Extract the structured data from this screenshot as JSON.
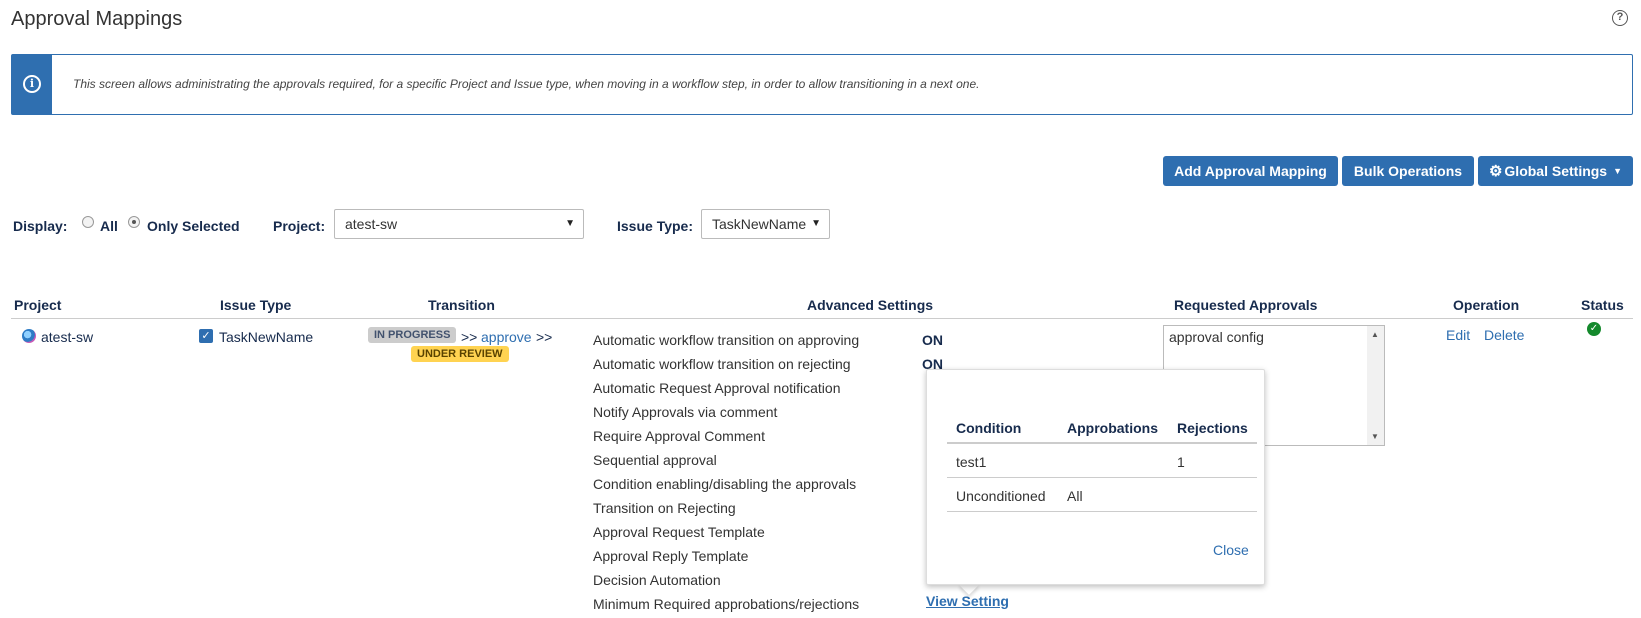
{
  "header": {
    "title": "Approval Mappings",
    "help_symbol": "?"
  },
  "info": {
    "icon_symbol": "i",
    "text": "This screen allows administrating the approvals required, for a specific Project and Issue type, when moving in a workflow step, in order to allow transitioning in a next one."
  },
  "toolbar": {
    "add_label": "Add Approval Mapping",
    "bulk_label": "Bulk Operations",
    "global_label": "Global Settings"
  },
  "filters": {
    "display_label": "Display:",
    "all_label": "All",
    "only_selected_label": "Only Selected",
    "selected_display": "Only Selected",
    "project_label": "Project:",
    "project_value": "atest-sw",
    "issue_type_label": "Issue Type:",
    "issue_type_value": "TaskNewName"
  },
  "table": {
    "columns": [
      "Project",
      "Issue Type",
      "Transition",
      "Advanced Settings",
      "Requested Approvals",
      "Operation",
      "Status"
    ],
    "row": {
      "project": "atest-sw",
      "issue_type": "TaskNewName",
      "transition_from": "IN PROGRESS",
      "transition_sep1": ">>",
      "transition_action": "approve",
      "transition_sep2": ">>",
      "transition_to": "UNDER REVIEW",
      "settings": [
        {
          "label": "Automatic workflow transition on approving",
          "value": "ON"
        },
        {
          "label": "Automatic workflow transition on rejecting",
          "value": "ON"
        },
        {
          "label": "Automatic Request Approval notification"
        },
        {
          "label": "Notify Approvals via comment"
        },
        {
          "label": "Require Approval Comment"
        },
        {
          "label": "Sequential approval"
        },
        {
          "label": "Condition enabling/disabling the approvals"
        },
        {
          "label": "Transition on Rejecting"
        },
        {
          "label": "Approval Request Template"
        },
        {
          "label": "Approval Reply Template"
        },
        {
          "label": "Decision Automation"
        },
        {
          "label": "Minimum Required approbations/rejections"
        }
      ],
      "view_setting_label": "View Setting",
      "requested_approvals": "approval config",
      "edit_label": "Edit",
      "delete_label": "Delete"
    }
  },
  "popup": {
    "columns": [
      "Condition",
      "Approbations",
      "Rejections"
    ],
    "rows": [
      {
        "condition": "test1",
        "approbations": "",
        "rejections": "1"
      },
      {
        "condition": "Unconditioned",
        "approbations": "All",
        "rejections": ""
      }
    ],
    "close_label": "Close"
  },
  "colors": {
    "accent": "#2e6eb0",
    "status_ok": "#14892c",
    "lozenge_in_progress": "#cccccc",
    "lozenge_under_review": "#ffd351"
  }
}
